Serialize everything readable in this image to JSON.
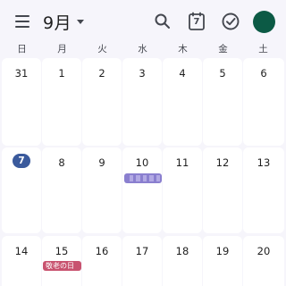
{
  "header": {
    "month_label": "9月",
    "today_icon_day": "7",
    "icons": {
      "menu": "hamburger-menu-icon",
      "dropdown": "caret-down-icon",
      "search": "search-icon",
      "today": "calendar-today-icon",
      "tasks": "check-circle-icon"
    },
    "avatar_color": "#0c5a45"
  },
  "weekdays": [
    "日",
    "月",
    "火",
    "水",
    "木",
    "金",
    "土"
  ],
  "weeks": [
    [
      "31",
      "1",
      "2",
      "3",
      "4",
      "5",
      "6"
    ],
    [
      "7",
      "8",
      "9",
      "10",
      "11",
      "12",
      "13"
    ],
    [
      "14",
      "15",
      "16",
      "17",
      "18",
      "19",
      "20"
    ]
  ],
  "today": "7",
  "events": {
    "redacted_event_day": "10",
    "holiday": {
      "day": "15",
      "label": "敬老の日"
    }
  },
  "colors": {
    "today_badge": "#3a5a9c",
    "redacted_event": "#8a7fcf",
    "holiday_event": "#c8526f",
    "background": "#f6f5fb",
    "cell": "#ffffff"
  }
}
